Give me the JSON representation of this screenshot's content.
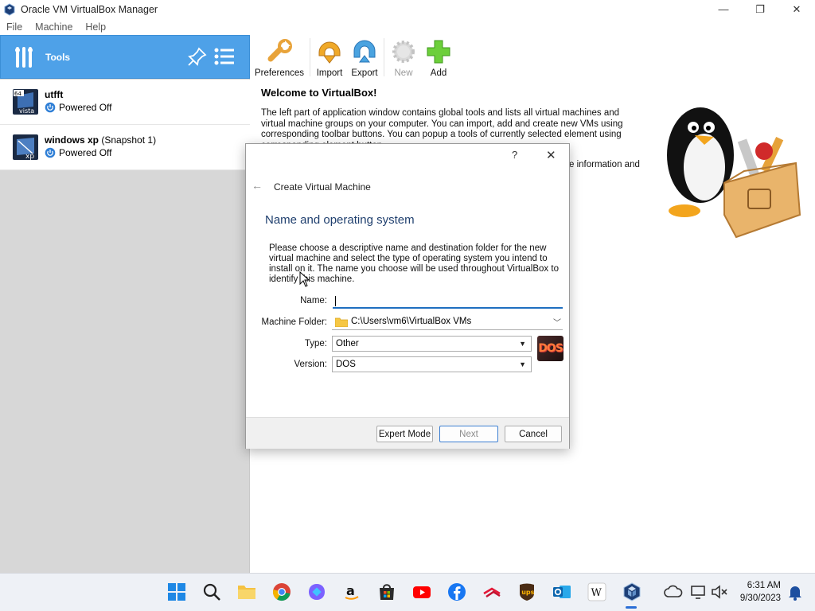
{
  "window": {
    "title": "Oracle VM VirtualBox Manager",
    "minimize_glyph": "—",
    "restore_glyph": "❐",
    "close_glyph": "✕"
  },
  "menu": [
    "File",
    "Machine",
    "Help"
  ],
  "left_pane": {
    "tools_label": "Tools",
    "vms": [
      {
        "name": "utfft",
        "snapshot": "",
        "state": "Powered Off",
        "os_badge": "vista",
        "bits": "64"
      },
      {
        "name": "windows xp",
        "snapshot": "(Snapshot 1)",
        "state": "Powered Off",
        "os_badge": "xp",
        "bits": ""
      }
    ]
  },
  "toolbar": {
    "preferences": "Preferences",
    "import": "Import",
    "export": "Export",
    "new": "New",
    "add": "Add"
  },
  "welcome": {
    "title": "Welcome to VirtualBox!",
    "text": "The left part of application window contains global tools and lists all virtual machines and virtual machine groups on your computer. You can import, add and create new VMs using corresponding toolbar buttons. You can popup a tools of currently selected element using corresponding element button.",
    "text_tail": "e information and"
  },
  "dialog": {
    "title": "Create Virtual Machine",
    "help_glyph": "?",
    "close_glyph": "✕",
    "back_glyph": "←",
    "heading": "Name and operating system",
    "description": "Please choose a descriptive name and destination folder for the new virtual machine and select the type of operating system you intend to install on it. The name you choose will be used throughout VirtualBox to identify this machine.",
    "name_label": "Name:",
    "name_value": "",
    "folder_label": "Machine Folder:",
    "folder_value": "C:\\Users\\vm6\\VirtualBox VMs",
    "type_label": "Type:",
    "type_value": "Other",
    "version_label": "Version:",
    "version_value": "DOS",
    "os_badge": "DOS",
    "expert_button": "Expert Mode",
    "next_button": "Next",
    "cancel_button": "Cancel"
  },
  "taskbar": {
    "time": "6:31 AM",
    "date": "9/30/2023",
    "apps": [
      "start",
      "search",
      "file-explorer",
      "chrome",
      "copilot",
      "amazon",
      "microsoft-store",
      "youtube",
      "facebook",
      "bank-of-america",
      "ups",
      "outlook",
      "wikipedia",
      "virtualbox"
    ]
  },
  "colors": {
    "tools_bg": "#4ea1e8",
    "accent": "#1f6fc0",
    "heading": "#1f3f6e"
  }
}
